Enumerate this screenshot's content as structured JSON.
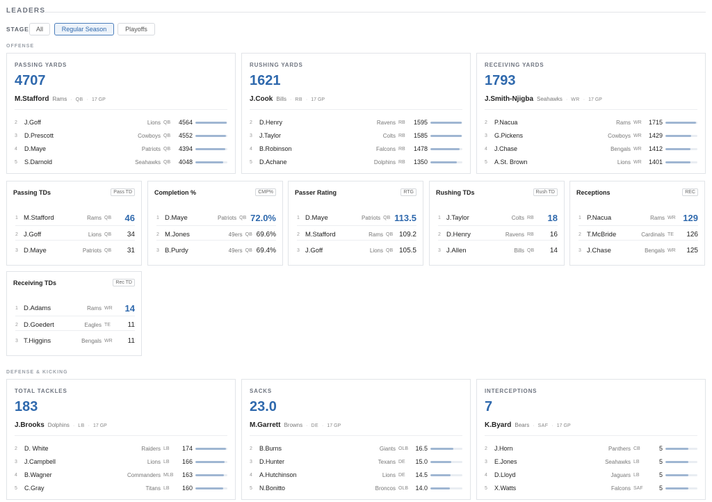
{
  "header": {
    "title": "LEADERS"
  },
  "stage": {
    "label": "STAGE",
    "options": [
      "All",
      "Regular Season",
      "Playoffs"
    ],
    "selected": "Regular Season"
  },
  "sections": {
    "offense": "OFFENSE",
    "defense": "DEFENSE & KICKING"
  },
  "accent_color": "#2f69ad",
  "big_cards": [
    {
      "id": "passing-yards",
      "category": "PASSING YARDS",
      "value": "4707",
      "leader": {
        "name": "M.Stafford",
        "team": "Rams",
        "pos": "QB",
        "gp": "17 GP"
      },
      "rows": [
        {
          "rank": "2",
          "name": "J.Goff",
          "team": "Lions",
          "pos": "QB",
          "value": "4564",
          "pct": 0.97
        },
        {
          "rank": "3",
          "name": "D.Prescott",
          "team": "Cowboys",
          "pos": "QB",
          "value": "4552",
          "pct": 0.967
        },
        {
          "rank": "4",
          "name": "D.Maye",
          "team": "Patriots",
          "pos": "QB",
          "value": "4394",
          "pct": 0.934
        },
        {
          "rank": "5",
          "name": "S.Darnold",
          "team": "Seahawks",
          "pos": "QB",
          "value": "4048",
          "pct": 0.86
        }
      ]
    },
    {
      "id": "rushing-yards",
      "category": "RUSHING YARDS",
      "value": "1621",
      "leader": {
        "name": "J.Cook",
        "team": "Bills",
        "pos": "RB",
        "gp": "17 GP"
      },
      "rows": [
        {
          "rank": "2",
          "name": "D.Henry",
          "team": "Ravens",
          "pos": "RB",
          "value": "1595",
          "pct": 0.984
        },
        {
          "rank": "3",
          "name": "J.Taylor",
          "team": "Colts",
          "pos": "RB",
          "value": "1585",
          "pct": 0.978
        },
        {
          "rank": "4",
          "name": "B.Robinson",
          "team": "Falcons",
          "pos": "RB",
          "value": "1478",
          "pct": 0.912
        },
        {
          "rank": "5",
          "name": "D.Achane",
          "team": "Dolphins",
          "pos": "RB",
          "value": "1350",
          "pct": 0.833
        }
      ]
    },
    {
      "id": "receiving-yards",
      "category": "RECEIVING YARDS",
      "value": "1793",
      "leader": {
        "name": "J.Smith-Njigba",
        "team": "Seahawks",
        "pos": "WR",
        "gp": "17 GP"
      },
      "rows": [
        {
          "rank": "2",
          "name": "P.Nacua",
          "team": "Rams",
          "pos": "WR",
          "value": "1715",
          "pct": 0.956
        },
        {
          "rank": "3",
          "name": "G.Pickens",
          "team": "Cowboys",
          "pos": "WR",
          "value": "1429",
          "pct": 0.797
        },
        {
          "rank": "4",
          "name": "J.Chase",
          "team": "Bengals",
          "pos": "WR",
          "value": "1412",
          "pct": 0.787
        },
        {
          "rank": "5",
          "name": "A.St. Brown",
          "team": "Lions",
          "pos": "WR",
          "value": "1401",
          "pct": 0.781
        }
      ]
    },
    {
      "id": "total-tackles",
      "category": "TOTAL TACKLES",
      "value": "183",
      "leader": {
        "name": "J.Brooks",
        "team": "Dolphins",
        "pos": "LB",
        "gp": "17 GP"
      },
      "rows": [
        {
          "rank": "2",
          "name": "D. White",
          "team": "Raiders",
          "pos": "LB",
          "value": "174",
          "pct": 0.95
        },
        {
          "rank": "3",
          "name": "J.Campbell",
          "team": "Lions",
          "pos": "LB",
          "value": "166",
          "pct": 0.907
        },
        {
          "rank": "4",
          "name": "B.Wagner",
          "team": "Commanders",
          "pos": "MLB",
          "value": "163",
          "pct": 0.89
        },
        {
          "rank": "5",
          "name": "C.Gray",
          "team": "Titans",
          "pos": "LB",
          "value": "160",
          "pct": 0.874
        }
      ]
    },
    {
      "id": "sacks",
      "category": "SACKS",
      "value": "23.0",
      "leader": {
        "name": "M.Garrett",
        "team": "Browns",
        "pos": "DE",
        "gp": "17 GP"
      },
      "rows": [
        {
          "rank": "2",
          "name": "B.Burns",
          "team": "Giants",
          "pos": "OLB",
          "value": "16.5",
          "pct": 0.717
        },
        {
          "rank": "3",
          "name": "D.Hunter",
          "team": "Texans",
          "pos": "DE",
          "value": "15.0",
          "pct": 0.652
        },
        {
          "rank": "4",
          "name": "A.Hutchinson",
          "team": "Lions",
          "pos": "DE",
          "value": "14.5",
          "pct": 0.63
        },
        {
          "rank": "5",
          "name": "N.Bonitto",
          "team": "Broncos",
          "pos": "OLB",
          "value": "14.0",
          "pct": 0.609
        }
      ]
    },
    {
      "id": "interceptions",
      "category": "INTERCEPTIONS",
      "value": "7",
      "leader": {
        "name": "K.Byard",
        "team": "Bears",
        "pos": "SAF",
        "gp": "17 GP"
      },
      "rows": [
        {
          "rank": "2",
          "name": "J.Horn",
          "team": "Panthers",
          "pos": "CB",
          "value": "5",
          "pct": 0.714
        },
        {
          "rank": "3",
          "name": "E.Jones",
          "team": "Seahawks",
          "pos": "LB",
          "value": "5",
          "pct": 0.714
        },
        {
          "rank": "4",
          "name": "D.Lloyd",
          "team": "Jaguars",
          "pos": "LB",
          "value": "5",
          "pct": 0.714
        },
        {
          "rank": "5",
          "name": "X.Watts",
          "team": "Falcons",
          "pos": "SAF",
          "value": "5",
          "pct": 0.714
        }
      ]
    }
  ],
  "small_cards": [
    {
      "id": "passing-tds",
      "title": "Passing TDs",
      "tag": "Pass TD",
      "rows": [
        {
          "rank": "1",
          "name": "M.Stafford",
          "team": "Rams",
          "pos": "QB",
          "value": "46"
        },
        {
          "rank": "2",
          "name": "J.Goff",
          "team": "Lions",
          "pos": "QB",
          "value": "34"
        },
        {
          "rank": "3",
          "name": "D.Maye",
          "team": "Patriots",
          "pos": "QB",
          "value": "31"
        }
      ]
    },
    {
      "id": "completion-pct",
      "title": "Completion %",
      "tag": "CMP%",
      "rows": [
        {
          "rank": "1",
          "name": "D.Maye",
          "team": "Patriots",
          "pos": "QB",
          "value": "72.0%"
        },
        {
          "rank": "2",
          "name": "M.Jones",
          "team": "49ers",
          "pos": "QB",
          "value": "69.6%"
        },
        {
          "rank": "3",
          "name": "B.Purdy",
          "team": "49ers",
          "pos": "QB",
          "value": "69.4%"
        }
      ]
    },
    {
      "id": "passer-rating",
      "title": "Passer Rating",
      "tag": "RTG",
      "rows": [
        {
          "rank": "1",
          "name": "D.Maye",
          "team": "Patriots",
          "pos": "QB",
          "value": "113.5"
        },
        {
          "rank": "2",
          "name": "M.Stafford",
          "team": "Rams",
          "pos": "QB",
          "value": "109.2"
        },
        {
          "rank": "3",
          "name": "J.Goff",
          "team": "Lions",
          "pos": "QB",
          "value": "105.5"
        }
      ]
    },
    {
      "id": "rushing-tds",
      "title": "Rushing TDs",
      "tag": "Rush TD",
      "rows": [
        {
          "rank": "1",
          "name": "J.Taylor",
          "team": "Colts",
          "pos": "RB",
          "value": "18"
        },
        {
          "rank": "2",
          "name": "D.Henry",
          "team": "Ravens",
          "pos": "RB",
          "value": "16"
        },
        {
          "rank": "3",
          "name": "J.Allen",
          "team": "Bills",
          "pos": "QB",
          "value": "14"
        }
      ]
    },
    {
      "id": "receptions",
      "title": "Receptions",
      "tag": "REC",
      "rows": [
        {
          "rank": "1",
          "name": "P.Nacua",
          "team": "Rams",
          "pos": "WR",
          "value": "129"
        },
        {
          "rank": "2",
          "name": "T.McBride",
          "team": "Cardinals",
          "pos": "TE",
          "value": "126"
        },
        {
          "rank": "3",
          "name": "J.Chase",
          "team": "Bengals",
          "pos": "WR",
          "value": "125"
        }
      ]
    },
    {
      "id": "receiving-tds",
      "title": "Receiving TDs",
      "tag": "Rec TD",
      "rows": [
        {
          "rank": "1",
          "name": "D.Adams",
          "team": "Rams",
          "pos": "WR",
          "value": "14"
        },
        {
          "rank": "2",
          "name": "D.Goedert",
          "team": "Eagles",
          "pos": "TE",
          "value": "11"
        },
        {
          "rank": "3",
          "name": "T.Higgins",
          "team": "Bengals",
          "pos": "WR",
          "value": "11"
        }
      ]
    }
  ]
}
